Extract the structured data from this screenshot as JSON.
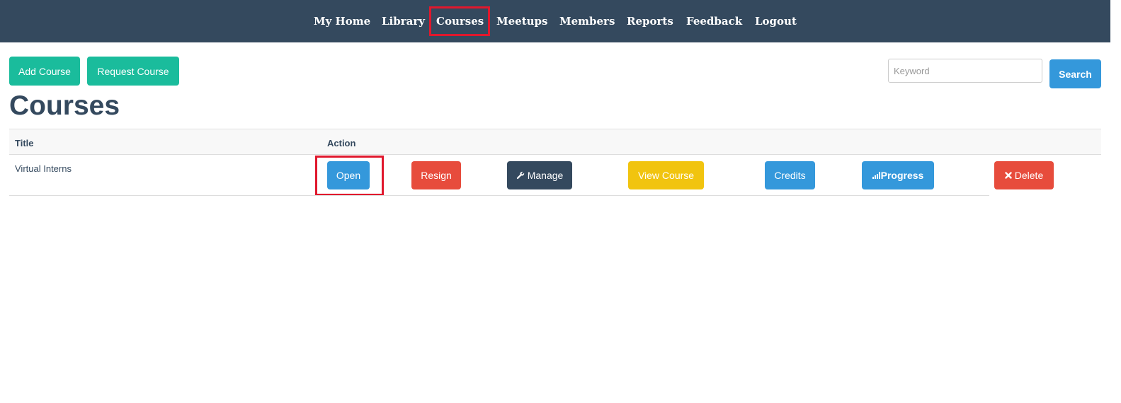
{
  "nav": {
    "items": [
      "My Home",
      "Library",
      "Courses",
      "Meetups",
      "Members",
      "Reports",
      "Feedback",
      "Logout"
    ],
    "active": "Courses",
    "background": "#34495e",
    "highlight_color": "#e0182d"
  },
  "toolbar": {
    "add_course": "Add Course",
    "request_course": "Request Course"
  },
  "search": {
    "placeholder": "Keyword",
    "button": "Search"
  },
  "page": {
    "title": "Courses"
  },
  "table": {
    "headers": {
      "title": "Title",
      "action": "Action"
    },
    "rows": [
      {
        "title": "Virtual Interns",
        "actions": {
          "open": "Open",
          "resign": "Resign",
          "manage": "Manage",
          "view_course": "View Course",
          "credits": "Credits",
          "progress": "Progress",
          "delete": "Delete"
        }
      }
    ]
  },
  "icons": {
    "manage": "wrench-icon",
    "progress": "signal-bars-icon",
    "delete": "x-mark-icon"
  },
  "colors": {
    "green": "#1abc9c",
    "blue": "#3498db",
    "red": "#e74c3c",
    "dark": "#34495e",
    "yellow": "#f1c40f"
  }
}
